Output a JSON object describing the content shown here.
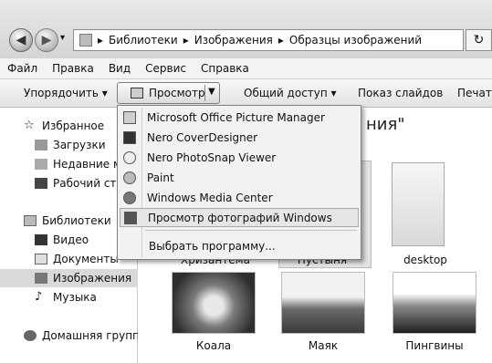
{
  "address": {
    "crumbs": [
      "Библиотеки",
      "Изображения",
      "Образцы изображений"
    ],
    "sep": "▸"
  },
  "menu": [
    "Файл",
    "Правка",
    "Вид",
    "Сервис",
    "Справка"
  ],
  "toolbar": {
    "organize": "Упорядочить ▾",
    "view": "Просмотр",
    "share": "Общий доступ ▾",
    "slideshow": "Показ слайдов",
    "print": "Печать"
  },
  "nav": {
    "favorites": "Избранное",
    "downloads": "Загрузки",
    "recent": "Недавние ме",
    "desktop": "Рабочий сто",
    "libraries": "Библиотеки",
    "video": "Видео",
    "documents": "Документы",
    "images": "Изображения",
    "music": "Музыка",
    "homegroup": "Домашняя группа"
  },
  "dropdown": {
    "items": [
      "Microsoft Office Picture Manager",
      "Nero CoverDesigner",
      "Nero PhotoSnap Viewer",
      "Paint",
      "Windows Media Center",
      "Просмотр фотографий Windows"
    ],
    "choose": "Выбрать программу..."
  },
  "content": {
    "header_fragment": "ния\"",
    "captions_row1": [
      "Хризантема",
      "Пустыня",
      "desktop"
    ],
    "captions_row2": [
      "Коала",
      "Маяк",
      "Пингвины"
    ]
  }
}
